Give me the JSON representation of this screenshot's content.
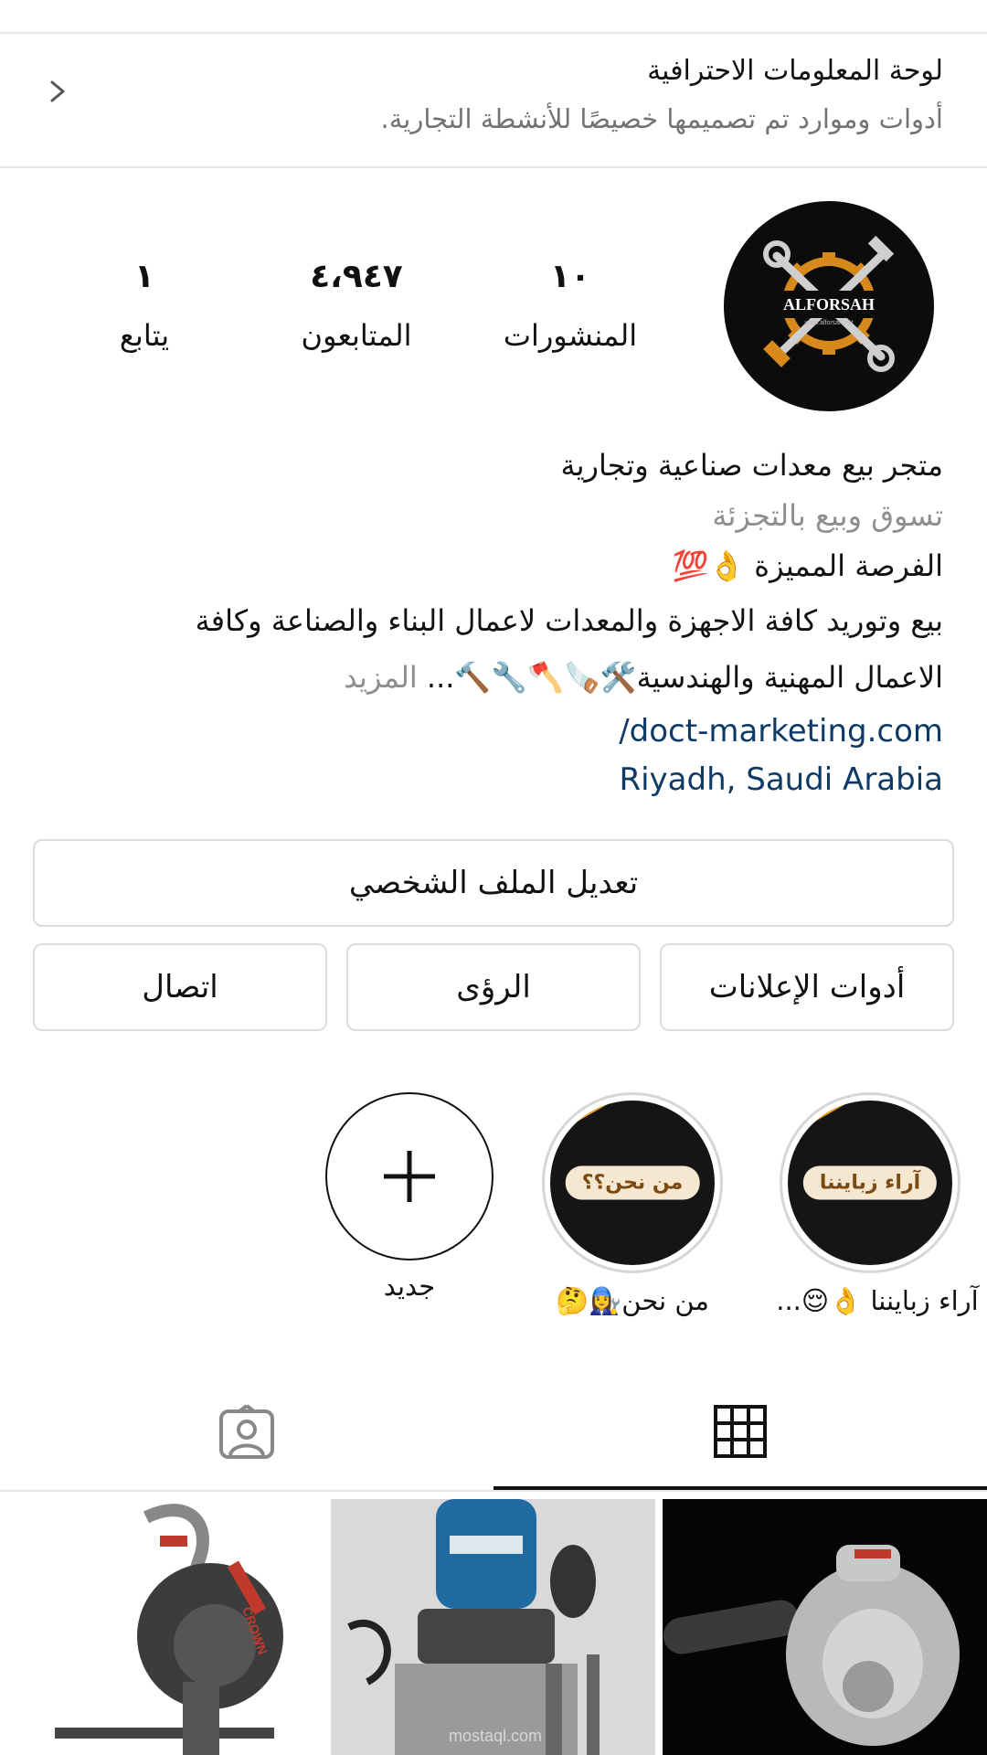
{
  "dashboard": {
    "title": "لوحة المعلومات الاحترافية",
    "subtitle": "أدوات وموارد تم تصميمها خصيصًا للأنشطة التجارية.",
    "chevron_icon": "chevron-right-icon"
  },
  "profile": {
    "logo_text": "ALFORSAH",
    "logo_url": "www.alforsah.net",
    "stats": {
      "posts_count": "١٠",
      "posts_label": "المنشورات",
      "followers_count": "٤،٩٤٧",
      "followers_label": "المتابعون",
      "following_count": "١",
      "following_label": "يتابع"
    }
  },
  "bio": {
    "name": "متجر بيع معدات صناعية وتجارية",
    "category": "تسوق وبيع بالتجزئة",
    "line1": "الفرصة المميزة 👌💯",
    "line2": "بيع وتوريد كافة الاجهزة والمعدات لاعمال البناء والصناعة وكافة",
    "line3": "الاعمال المهنية والهندسية🛠️🪚🪓🔧🔨...",
    "more": "المزيد",
    "website": "/doct-marketing.com",
    "location": "Riyadh, Saudi Arabia"
  },
  "buttons": {
    "edit_profile": "تعديل الملف الشخصي",
    "ad_tools": "أدوات الإعلانات",
    "insights": "الرؤى",
    "contact": "اتصال"
  },
  "highlights": [
    {
      "cover_text": "آراء زبايننا",
      "label": "آراء زبايننا 👌😌..."
    },
    {
      "cover_text": "من نحن؟؟",
      "label": "من نحن👩‍🔧🤔"
    },
    {
      "label": "جديد",
      "icon": "plus-icon"
    }
  ],
  "tabs": {
    "grid_icon": "grid-icon",
    "tagged_icon": "tagged-person-icon"
  },
  "posts": [
    {
      "description": "leaf-blower"
    },
    {
      "description": "router-tool",
      "watermark": "mostaql.com"
    },
    {
      "description": "cut-off-saw",
      "brand": "CROWN"
    }
  ],
  "colors": {
    "link": "#0e3a66",
    "muted": "#737373",
    "border": "#dcdcdc",
    "highlight_orange": "#f2a31b"
  }
}
